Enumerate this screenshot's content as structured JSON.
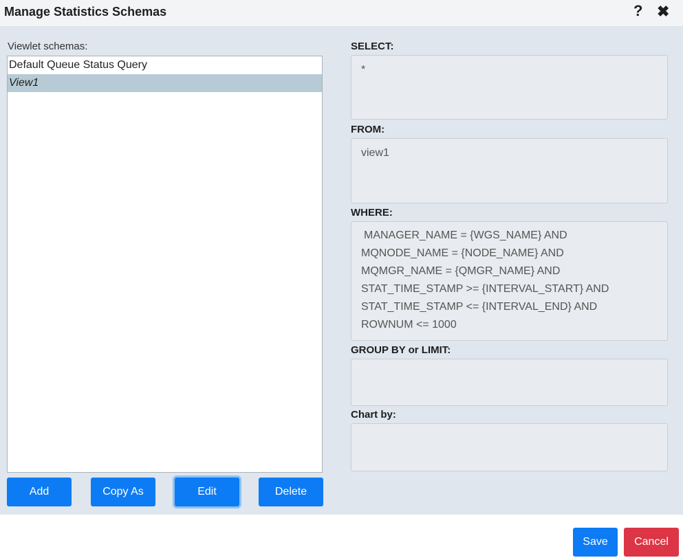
{
  "dialog": {
    "title": "Manage Statistics Schemas",
    "help_icon": "?",
    "close_icon": "✖"
  },
  "schemas": {
    "label": "Viewlet schemas:",
    "items": [
      {
        "label": "Default Queue Status Query",
        "selected": false
      },
      {
        "label": "View1",
        "selected": true
      }
    ]
  },
  "buttons": {
    "add": "Add",
    "copy_as": "Copy As",
    "edit": "Edit",
    "delete": "Delete"
  },
  "query": {
    "select_label": "SELECT:",
    "select_value": "*",
    "from_label": "FROM:",
    "from_value": "view1",
    "where_label": "WHERE:",
    "where_lines": [
      " MANAGER_NAME = {WGS_NAME} AND",
      "MQNODE_NAME = {NODE_NAME} AND",
      "MQMGR_NAME = {QMGR_NAME} AND",
      "STAT_TIME_STAMP >= {INTERVAL_START} AND",
      "STAT_TIME_STAMP <= {INTERVAL_END} AND",
      "ROWNUM <= 1000"
    ],
    "group_label": "GROUP BY or LIMIT:",
    "group_value": "",
    "chart_label": "Chart by:",
    "chart_value": ""
  },
  "footer": {
    "save": "Save",
    "cancel": "Cancel"
  },
  "colors": {
    "primary": "#0d7bf3",
    "danger": "#dc3545",
    "panel": "#dfe6ee",
    "selected_row": "#b6cbd5"
  }
}
